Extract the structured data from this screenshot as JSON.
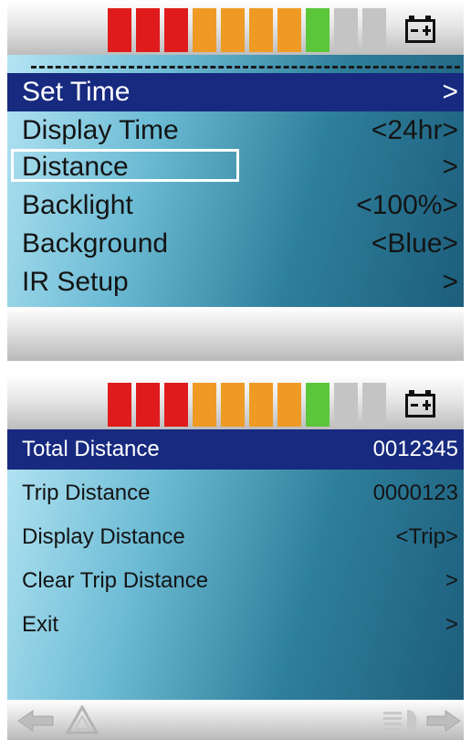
{
  "colors": {
    "segments": [
      "#e01b1b",
      "#e01b1b",
      "#e01b1b",
      "#ef9a24",
      "#ef9a24",
      "#ef9a24",
      "#ef9a24",
      "#5bc63a",
      "#c4c4c4",
      "#c4c4c4"
    ],
    "selected_row_bg": "#172a80"
  },
  "battery_level": {
    "lit_segments": 8,
    "total_segments": 10
  },
  "screen1": {
    "menu": [
      {
        "label": "Set Time",
        "value": ">"
      },
      {
        "label": "Display Time",
        "value": "<24hr>"
      },
      {
        "label": "Distance",
        "value": ">"
      },
      {
        "label": "Backlight",
        "value": "<100%>"
      },
      {
        "label": "Background",
        "value": "<Blue>"
      },
      {
        "label": "IR Setup",
        "value": ">"
      }
    ]
  },
  "screen2": {
    "menu": [
      {
        "label": "Total Distance",
        "value": "0012345"
      },
      {
        "label": "Trip Distance",
        "value": "0000123"
      },
      {
        "label": "Display Distance",
        "value": "<Trip>"
      },
      {
        "label": "Clear Trip Distance",
        "value": ">"
      },
      {
        "label": "Exit",
        "value": ">"
      }
    ],
    "bottom_icons": [
      "left-arrow-icon",
      "hazard-warning-icon",
      "headlight-icon",
      "right-arrow-icon"
    ]
  }
}
